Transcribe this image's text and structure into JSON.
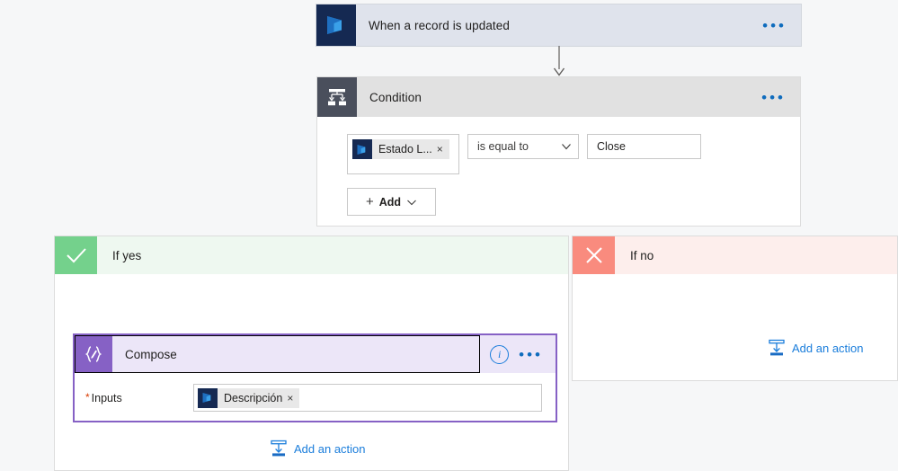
{
  "flow": {
    "trigger": {
      "title": "When a record is updated",
      "icon": "dynamics365-icon",
      "menu_icon": "ellipsis-icon"
    },
    "connector": {
      "icon": "down-arrow-icon"
    },
    "condition": {
      "title": "Condition",
      "icon": "condition-icon",
      "menu_icon": "ellipsis-icon",
      "row": {
        "left_token": {
          "label": "Estado L...",
          "icon": "dynamics365-icon",
          "remove_icon": "×"
        },
        "operator": {
          "value": "is equal to",
          "chevron_icon": "chevron-down-icon"
        },
        "right_value": "Close"
      },
      "add_button": {
        "label": "Add",
        "plus_icon": "+",
        "chevron_icon": "chevron-down-icon"
      }
    },
    "branch_yes": {
      "label": "If yes",
      "badge_icon": "checkmark-icon",
      "badge_color": "#74d18c",
      "header_color": "#eef8f0",
      "action": {
        "title": "Compose",
        "icon": "compose-icon",
        "icon_color": "#8661c5",
        "info_icon": "info-icon",
        "menu_icon": "ellipsis-icon",
        "inputs_label": "Inputs",
        "required_marker": "*",
        "input_token": {
          "label": "Descripción",
          "icon": "dynamics365-icon",
          "remove_icon": "×"
        }
      },
      "add_action": {
        "label": "Add an action",
        "icon": "add-action-icon"
      }
    },
    "branch_no": {
      "label": "If no",
      "badge_icon": "close-icon",
      "badge_color": "#f98b7e",
      "header_color": "#fdeeec",
      "add_action": {
        "label": "Add an action",
        "icon": "add-action-icon"
      }
    }
  }
}
